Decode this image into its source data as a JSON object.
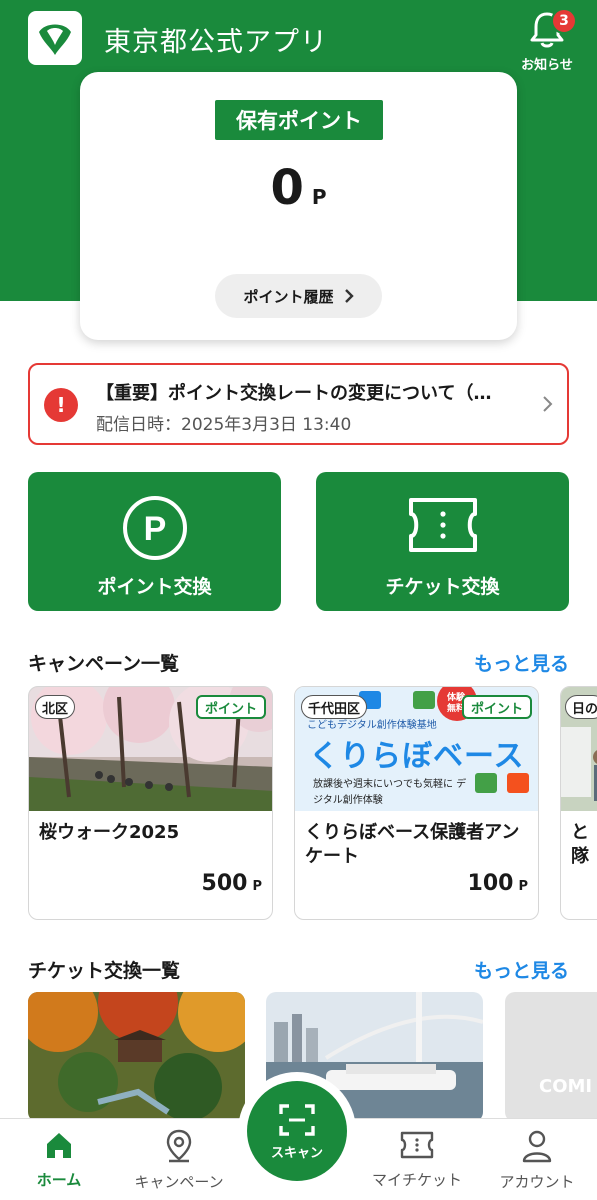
{
  "app": {
    "title": "東京都公式アプリ",
    "notice_label": "お知らせ",
    "notice_count": "3"
  },
  "points": {
    "label": "保有ポイント",
    "value": "0",
    "unit": "P",
    "history_label": "ポイント履歴"
  },
  "alert": {
    "title": "【重要】ポイント交換レートの変更について（…",
    "date": "配信日時：2025年3月3日 13:40"
  },
  "actions": {
    "point_exchange": "ポイント交換",
    "ticket_exchange": "チケット交換"
  },
  "campaigns": {
    "title": "キャンペーン一覧",
    "more": "もっと見る",
    "items": [
      {
        "region": "北区",
        "tag": "ポイント",
        "title": "桜ウォーク2025",
        "points": "500",
        "unit": "P"
      },
      {
        "region": "千代田区",
        "tag": "ポイント",
        "title": "くりらぼベース保護者アンケート",
        "points": "100",
        "unit": "P",
        "image_heading": "くりらぼベース",
        "image_top": "こどもデジタル創作体験基地",
        "image_body": "放課後や週末にいつでも気軽に デジタル創作体験",
        "image_badge": "体験無料"
      },
      {
        "region": "日の",
        "title": "と隊"
      }
    ]
  },
  "tickets": {
    "title": "チケット交換一覧",
    "more": "もっと見る",
    "coming": "COMI"
  },
  "nav": {
    "home": "ホーム",
    "campaign": "キャンペーン",
    "scan": "スキャン",
    "my_ticket": "マイチケット",
    "account": "アカウント"
  },
  "colors": {
    "brand_green": "#1a8a3c",
    "alert_red": "#e53935",
    "link_blue": "#1e88e5"
  }
}
